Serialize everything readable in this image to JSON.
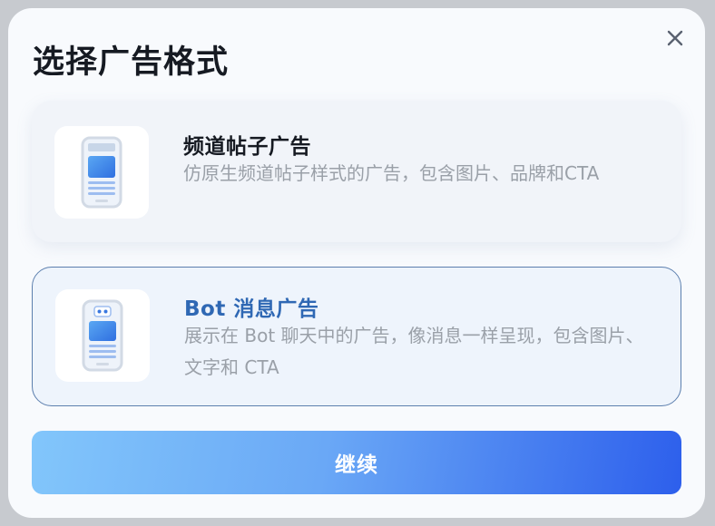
{
  "dialog": {
    "title": "选择广告格式",
    "close_icon": "close-icon"
  },
  "options": [
    {
      "title": "频道帖子广告",
      "description": "仿原生频道帖子样式的广告，包含图片、品牌和CTA",
      "icon": "phone-post-icon",
      "selected": false
    },
    {
      "title": "Bot 消息广告",
      "description": "展示在 Bot 聊天中的广告，像消息一样呈现，包含图片、文字和 CTA",
      "icon": "phone-bot-message-icon",
      "selected": true
    }
  ],
  "continue_button": {
    "label": "继续"
  },
  "colors": {
    "accent_blue": "#2f68b4",
    "button_gradient_start": "#82c6fb",
    "button_gradient_end": "#2d5fec",
    "selected_border": "#5c7fae"
  }
}
